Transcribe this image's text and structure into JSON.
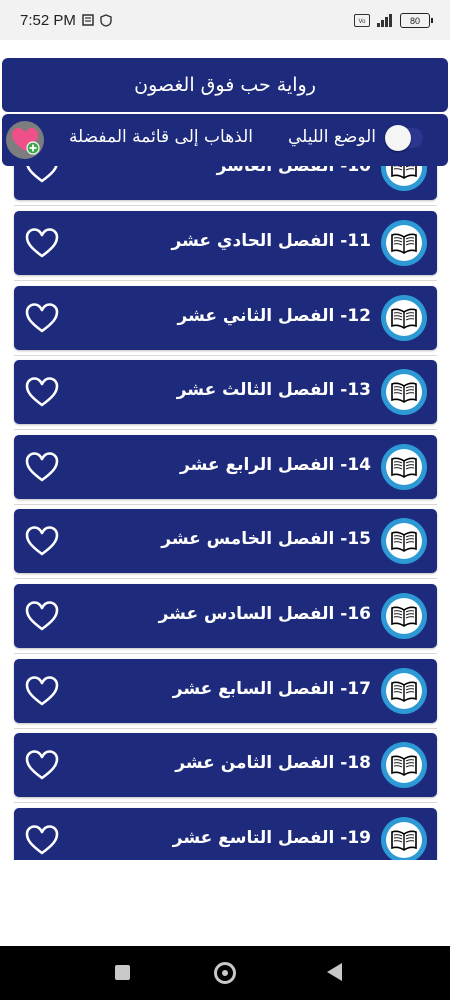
{
  "status_bar": {
    "time": "7:52 PM",
    "battery": "80",
    "network_type": "VoLTE",
    "icons": [
      "sim-card-icon",
      "shield-hand-icon",
      "volte-icon",
      "signal-icon",
      "battery-icon"
    ]
  },
  "header": {
    "title": "رواية حب فوق الغصون"
  },
  "options": {
    "night_mode_label": "الوضع الليلي",
    "night_mode_enabled": false,
    "favorites_label": "الذهاب إلى قائمة المفضلة"
  },
  "chapters": [
    {
      "label": "10- الفصل العاشر",
      "favorite": false
    },
    {
      "label": "11- الفصل الحادي عشر",
      "favorite": false
    },
    {
      "label": "12- الفصل الثاني عشر",
      "favorite": false
    },
    {
      "label": "13- الفصل الثالث عشر",
      "favorite": false
    },
    {
      "label": "14- الفصل الرابع عشر",
      "favorite": false
    },
    {
      "label": "15- الفصل الخامس عشر",
      "favorite": false
    },
    {
      "label": "16- الفصل السادس عشر",
      "favorite": false
    },
    {
      "label": "17- الفصل السابع عشر",
      "favorite": false
    },
    {
      "label": "18- الفصل الثامن عشر",
      "favorite": false
    },
    {
      "label": "19- الفصل التاسع عشر",
      "favorite": false
    }
  ],
  "colors": {
    "primary": "#1e2a7c",
    "book_icon_ring": "#2d9ad6",
    "heart_pink": "#f0508a"
  },
  "nav_bar": {
    "icons": [
      "recents-icon",
      "home-icon",
      "back-icon"
    ]
  }
}
